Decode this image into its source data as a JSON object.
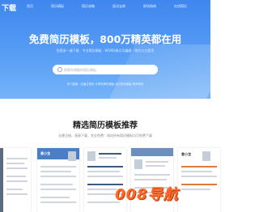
{
  "nav": {
    "logo": "下载",
    "items": [
      "首页",
      "简历模板",
      "简历攻略",
      "面试宝典",
      "职场指南",
      "在线简历"
    ]
  },
  "hero": {
    "title": "免费简历模板，800万精英都在用",
    "subtitle": "免登录一键下载 · 专业简历模板 · WORD格式可编辑 · 简约大方套用",
    "search_placeholder": "搜索你想要的简历模板",
    "hotwords": "热门搜索：应届生简历 计算机简历模板 会计简历模板 教师简历"
  },
  "section": {
    "title": "精选简历模板推荐",
    "subtitle": "无需注册，直接下载，完全免费！网站所有简历模板均可免费下载"
  },
  "cards": [
    {
      "name": "",
      "accent": "#5a6b7d"
    },
    {
      "name": "曾小龙",
      "accent": "#4a7fc7"
    },
    {
      "name": "",
      "accent": "#3c5a80"
    },
    {
      "name": "",
      "accent": "#6b8fbf"
    },
    {
      "name": "曾小龙",
      "accent": "#e07a3a"
    }
  ],
  "watermark": "008导航",
  "colors": {
    "hero": "#4a8ff2",
    "watermark": "#ff6b2c"
  }
}
